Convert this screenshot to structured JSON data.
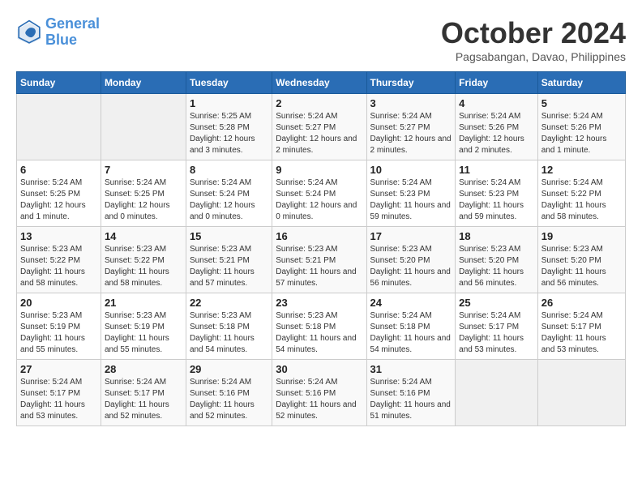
{
  "logo": {
    "line1": "General",
    "line2": "Blue"
  },
  "title": "October 2024",
  "subtitle": "Pagsabangan, Davao, Philippines",
  "days_of_week": [
    "Sunday",
    "Monday",
    "Tuesday",
    "Wednesday",
    "Thursday",
    "Friday",
    "Saturday"
  ],
  "weeks": [
    [
      {
        "day": "",
        "info": ""
      },
      {
        "day": "",
        "info": ""
      },
      {
        "day": "1",
        "info": "Sunrise: 5:25 AM\nSunset: 5:28 PM\nDaylight: 12 hours and 3 minutes."
      },
      {
        "day": "2",
        "info": "Sunrise: 5:24 AM\nSunset: 5:27 PM\nDaylight: 12 hours and 2 minutes."
      },
      {
        "day": "3",
        "info": "Sunrise: 5:24 AM\nSunset: 5:27 PM\nDaylight: 12 hours and 2 minutes."
      },
      {
        "day": "4",
        "info": "Sunrise: 5:24 AM\nSunset: 5:26 PM\nDaylight: 12 hours and 2 minutes."
      },
      {
        "day": "5",
        "info": "Sunrise: 5:24 AM\nSunset: 5:26 PM\nDaylight: 12 hours and 1 minute."
      }
    ],
    [
      {
        "day": "6",
        "info": "Sunrise: 5:24 AM\nSunset: 5:25 PM\nDaylight: 12 hours and 1 minute."
      },
      {
        "day": "7",
        "info": "Sunrise: 5:24 AM\nSunset: 5:25 PM\nDaylight: 12 hours and 0 minutes."
      },
      {
        "day": "8",
        "info": "Sunrise: 5:24 AM\nSunset: 5:24 PM\nDaylight: 12 hours and 0 minutes."
      },
      {
        "day": "9",
        "info": "Sunrise: 5:24 AM\nSunset: 5:24 PM\nDaylight: 12 hours and 0 minutes."
      },
      {
        "day": "10",
        "info": "Sunrise: 5:24 AM\nSunset: 5:23 PM\nDaylight: 11 hours and 59 minutes."
      },
      {
        "day": "11",
        "info": "Sunrise: 5:24 AM\nSunset: 5:23 PM\nDaylight: 11 hours and 59 minutes."
      },
      {
        "day": "12",
        "info": "Sunrise: 5:24 AM\nSunset: 5:22 PM\nDaylight: 11 hours and 58 minutes."
      }
    ],
    [
      {
        "day": "13",
        "info": "Sunrise: 5:23 AM\nSunset: 5:22 PM\nDaylight: 11 hours and 58 minutes."
      },
      {
        "day": "14",
        "info": "Sunrise: 5:23 AM\nSunset: 5:22 PM\nDaylight: 11 hours and 58 minutes."
      },
      {
        "day": "15",
        "info": "Sunrise: 5:23 AM\nSunset: 5:21 PM\nDaylight: 11 hours and 57 minutes."
      },
      {
        "day": "16",
        "info": "Sunrise: 5:23 AM\nSunset: 5:21 PM\nDaylight: 11 hours and 57 minutes."
      },
      {
        "day": "17",
        "info": "Sunrise: 5:23 AM\nSunset: 5:20 PM\nDaylight: 11 hours and 56 minutes."
      },
      {
        "day": "18",
        "info": "Sunrise: 5:23 AM\nSunset: 5:20 PM\nDaylight: 11 hours and 56 minutes."
      },
      {
        "day": "19",
        "info": "Sunrise: 5:23 AM\nSunset: 5:20 PM\nDaylight: 11 hours and 56 minutes."
      }
    ],
    [
      {
        "day": "20",
        "info": "Sunrise: 5:23 AM\nSunset: 5:19 PM\nDaylight: 11 hours and 55 minutes."
      },
      {
        "day": "21",
        "info": "Sunrise: 5:23 AM\nSunset: 5:19 PM\nDaylight: 11 hours and 55 minutes."
      },
      {
        "day": "22",
        "info": "Sunrise: 5:23 AM\nSunset: 5:18 PM\nDaylight: 11 hours and 54 minutes."
      },
      {
        "day": "23",
        "info": "Sunrise: 5:23 AM\nSunset: 5:18 PM\nDaylight: 11 hours and 54 minutes."
      },
      {
        "day": "24",
        "info": "Sunrise: 5:24 AM\nSunset: 5:18 PM\nDaylight: 11 hours and 54 minutes."
      },
      {
        "day": "25",
        "info": "Sunrise: 5:24 AM\nSunset: 5:17 PM\nDaylight: 11 hours and 53 minutes."
      },
      {
        "day": "26",
        "info": "Sunrise: 5:24 AM\nSunset: 5:17 PM\nDaylight: 11 hours and 53 minutes."
      }
    ],
    [
      {
        "day": "27",
        "info": "Sunrise: 5:24 AM\nSunset: 5:17 PM\nDaylight: 11 hours and 53 minutes."
      },
      {
        "day": "28",
        "info": "Sunrise: 5:24 AM\nSunset: 5:17 PM\nDaylight: 11 hours and 52 minutes."
      },
      {
        "day": "29",
        "info": "Sunrise: 5:24 AM\nSunset: 5:16 PM\nDaylight: 11 hours and 52 minutes."
      },
      {
        "day": "30",
        "info": "Sunrise: 5:24 AM\nSunset: 5:16 PM\nDaylight: 11 hours and 52 minutes."
      },
      {
        "day": "31",
        "info": "Sunrise: 5:24 AM\nSunset: 5:16 PM\nDaylight: 11 hours and 51 minutes."
      },
      {
        "day": "",
        "info": ""
      },
      {
        "day": "",
        "info": ""
      }
    ]
  ]
}
